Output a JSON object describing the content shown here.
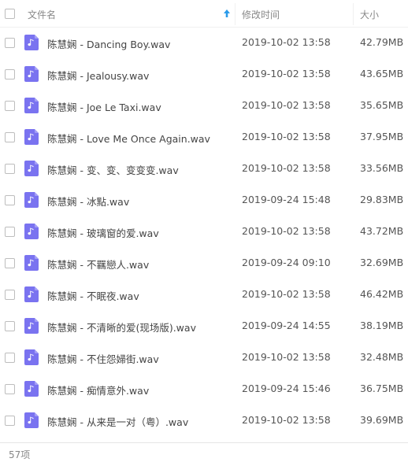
{
  "header": {
    "name_label": "文件名",
    "time_label": "修改时间",
    "size_label": "大小",
    "sort_icon": "arrow-up-icon",
    "accent_color": "#2b9bea"
  },
  "file_icon": {
    "name": "music-file-icon",
    "color": "#7a73f0"
  },
  "files": [
    {
      "name": "陈慧娴 - Dancing Boy.wav",
      "modified": "2019-10-02 13:58",
      "size": "42.79MB"
    },
    {
      "name": "陈慧娴 - Jealousy.wav",
      "modified": "2019-10-02 13:58",
      "size": "43.65MB"
    },
    {
      "name": "陈慧娴 - Joe Le Taxi.wav",
      "modified": "2019-10-02 13:58",
      "size": "35.65MB"
    },
    {
      "name": "陈慧娴 - Love Me Once Again.wav",
      "modified": "2019-10-02 13:58",
      "size": "37.95MB"
    },
    {
      "name": "陈慧娴 - 变、变、变变变.wav",
      "modified": "2019-10-02 13:58",
      "size": "33.56MB"
    },
    {
      "name": "陈慧娴 - 冰點.wav",
      "modified": "2019-09-24 15:48",
      "size": "29.83MB"
    },
    {
      "name": "陈慧娴 - 玻璃窗的爱.wav",
      "modified": "2019-10-02 13:58",
      "size": "43.72MB"
    },
    {
      "name": "陈慧娴 - 不羈戀人.wav",
      "modified": "2019-09-24 09:10",
      "size": "32.69MB"
    },
    {
      "name": "陈慧娴 - 不眠夜.wav",
      "modified": "2019-10-02 13:58",
      "size": "46.42MB"
    },
    {
      "name": "陈慧娴 - 不清晰的爱(现场版).wav",
      "modified": "2019-09-24 14:55",
      "size": "38.19MB"
    },
    {
      "name": "陈慧娴 - 不住怨婦街.wav",
      "modified": "2019-10-02 13:58",
      "size": "32.48MB"
    },
    {
      "name": "陈慧娴 - 痴情意外.wav",
      "modified": "2019-09-24 15:46",
      "size": "36.75MB"
    },
    {
      "name": "陈慧娴 - 从来是一对（粤）.wav",
      "modified": "2019-10-02 13:58",
      "size": "39.69MB"
    }
  ],
  "footer": {
    "count_label": "57项"
  }
}
